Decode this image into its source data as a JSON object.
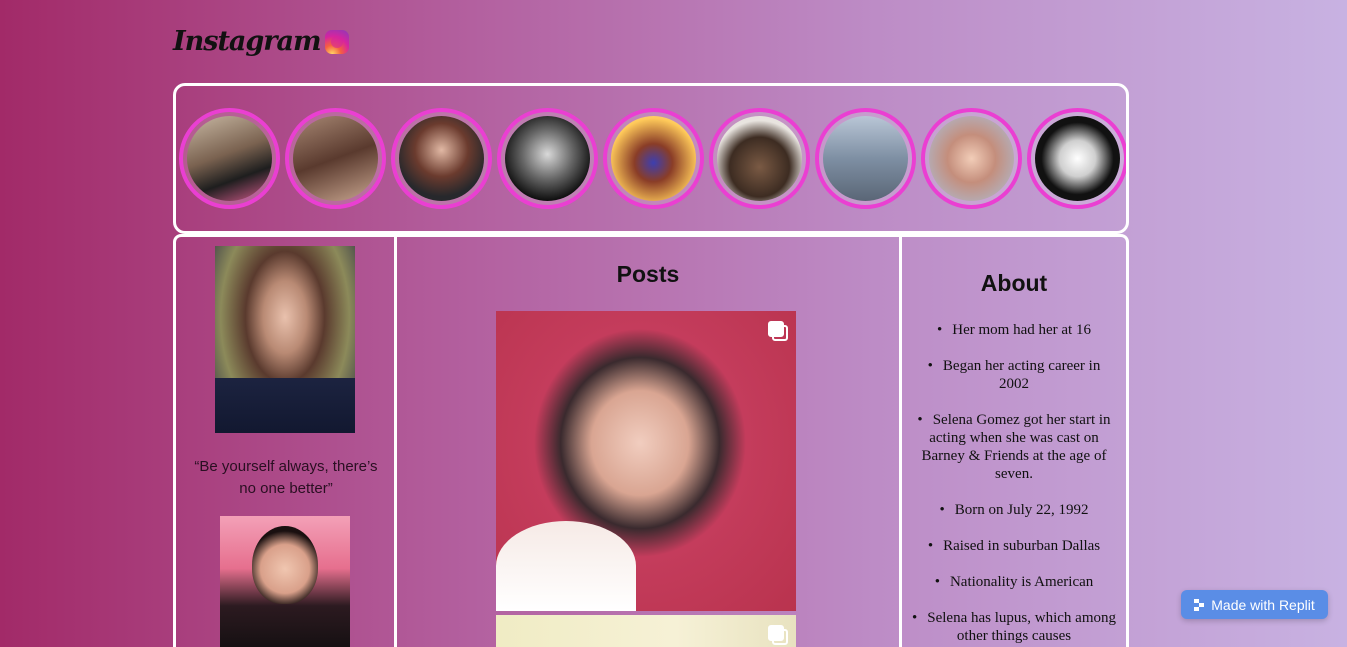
{
  "header": {
    "logo_text": "Instagram",
    "logo_icon": "instagram-icon"
  },
  "stories": [
    {
      "name": "story-1"
    },
    {
      "name": "story-2"
    },
    {
      "name": "story-3"
    },
    {
      "name": "story-4"
    },
    {
      "name": "story-5"
    },
    {
      "name": "story-6"
    },
    {
      "name": "story-7"
    },
    {
      "name": "story-8"
    },
    {
      "name": "story-9"
    }
  ],
  "profile": {
    "quote": "“Be yourself always, there’s no one better”"
  },
  "posts": {
    "title": "Posts"
  },
  "about": {
    "title": "About",
    "items": [
      "Her mom had her at 16",
      "Began her acting career in 2002",
      "Selena Gomez got her start in acting when she was cast on Barney & Friends at the age of seven.",
      "Born on July 22, 1992",
      "Raised in suburban Dallas",
      "Nationality is American",
      "Selena has lupus, which among other things causes"
    ]
  },
  "badge": {
    "label": "Made with Replit"
  },
  "colors": {
    "story_ring": "#ea3fd2",
    "badge": "#5a8de6"
  }
}
